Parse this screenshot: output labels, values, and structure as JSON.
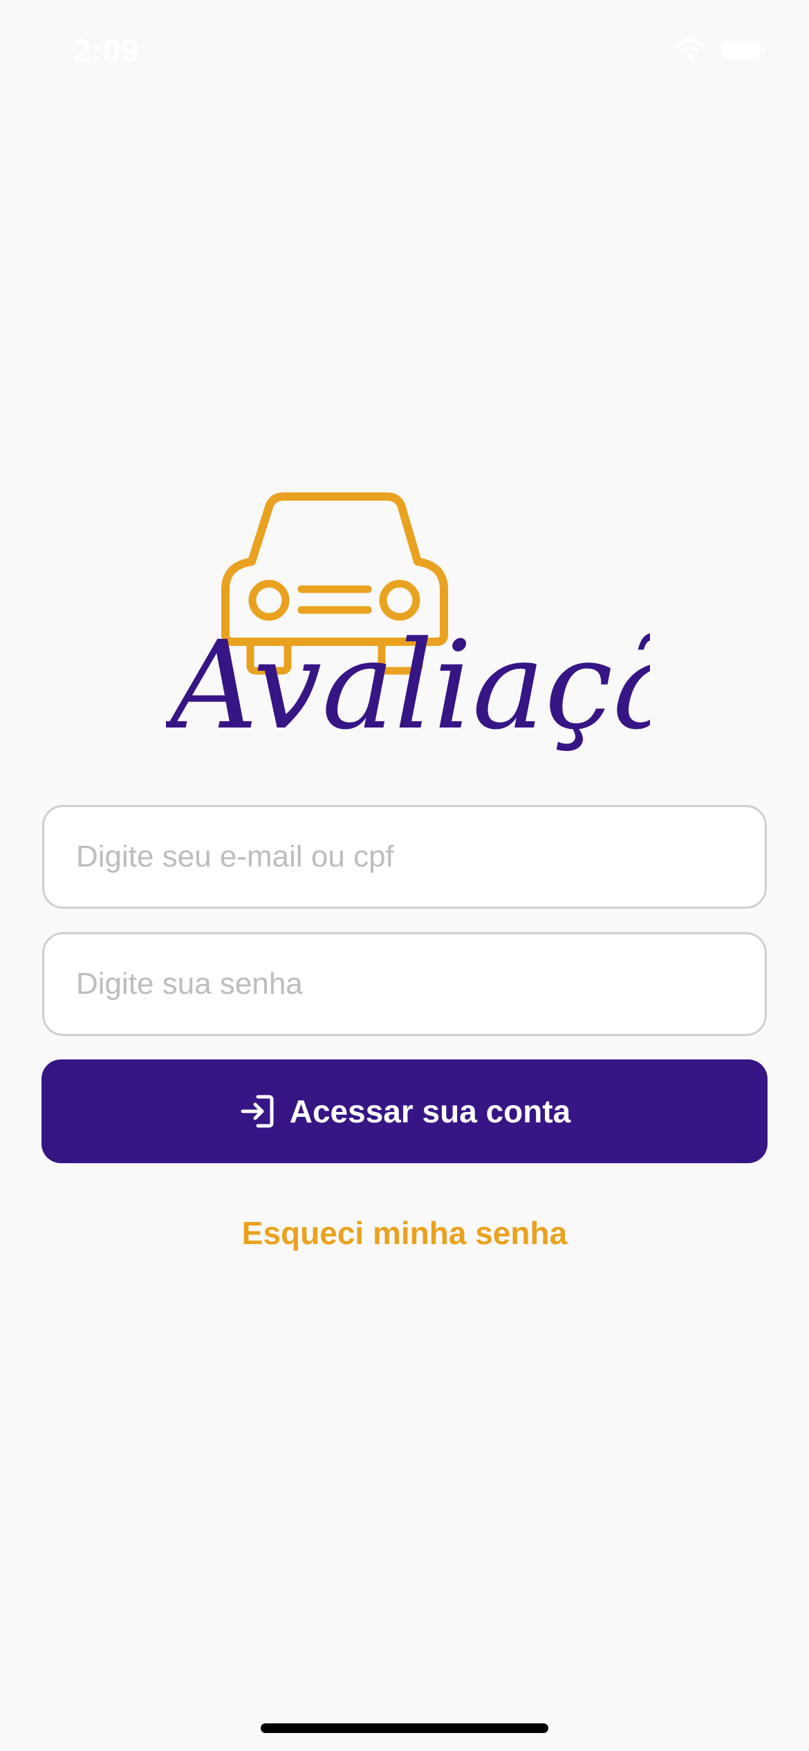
{
  "status_bar": {
    "time": "2:09",
    "wifi_icon": "wifi-icon",
    "battery_icon": "battery-icon"
  },
  "logo": {
    "text": "Avaliação",
    "icon": "car-icon"
  },
  "login_form": {
    "email_placeholder": "Digite seu e-mail ou cpf",
    "email_value": "",
    "password_placeholder": "Digite sua senha",
    "password_value": "",
    "submit_label": "Acessar sua conta",
    "submit_icon": "login-icon",
    "forgot_password_label": "Esqueci minha senha"
  },
  "colors": {
    "brand_purple": "#361585",
    "accent_orange": "#E9A21F",
    "background": "#F9F9F9",
    "field_border": "#CFCFCF",
    "placeholder": "#BDBDBD"
  }
}
